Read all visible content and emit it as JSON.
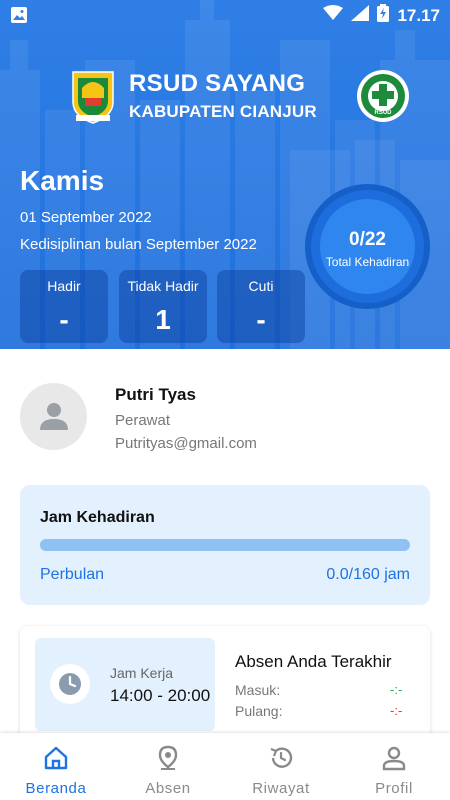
{
  "status_bar": {
    "time": "17.17",
    "left_icon": "image-icon",
    "icons": [
      "wifi-icon",
      "signal-icon",
      "battery-charging-icon"
    ]
  },
  "brand": {
    "title": "RSUD SAYANG",
    "subtitle": "KABUPATEN CIANJUR",
    "left_logo": "cianjur-regency-emblem",
    "right_logo": "rsud-emblem",
    "right_logo_text": "RSUD"
  },
  "header": {
    "day": "Kamis",
    "date": "01 September 2022",
    "discipline": "Kedisiplinan bulan September 2022"
  },
  "stats": [
    {
      "label": "Hadir",
      "value": "-"
    },
    {
      "label": "Tidak Hadir",
      "value": "1"
    },
    {
      "label": "Cuti",
      "value": "-"
    }
  ],
  "attendance_total": {
    "value": "0/22",
    "caption": "Total Kehadiran"
  },
  "profile": {
    "name": "Putri Tyas",
    "role": "Perawat",
    "email": "Putrityas@gmail.com",
    "avatar_icon": "person-icon"
  },
  "jam_kehadiran": {
    "title": "Jam Kehadiran",
    "period": "Perbulan",
    "summary": "0.0/160 jam",
    "progress_fraction": 0.0
  },
  "last_absence": {
    "work_label": "Jam Kerja",
    "work_hours": "14:00 - 20:00",
    "title": "Absen Anda Terakhir",
    "masuk_label": "Masuk:",
    "masuk_value": "-:-",
    "pulang_label": "Pulang:",
    "pulang_value": "-:-"
  },
  "nav": [
    {
      "label": "Beranda",
      "icon": "home-icon",
      "active": true
    },
    {
      "label": "Absen",
      "icon": "location-pin-icon",
      "active": false
    },
    {
      "label": "Riwayat",
      "icon": "history-icon",
      "active": false
    },
    {
      "label": "Profil",
      "icon": "person-icon",
      "active": false
    }
  ],
  "colors": {
    "primary": "#1f73e0",
    "header_bg": "#2a7be4",
    "card_bg": "#e3f0fd",
    "masuk": "#2aa84a",
    "pulang": "#e03a3a"
  }
}
